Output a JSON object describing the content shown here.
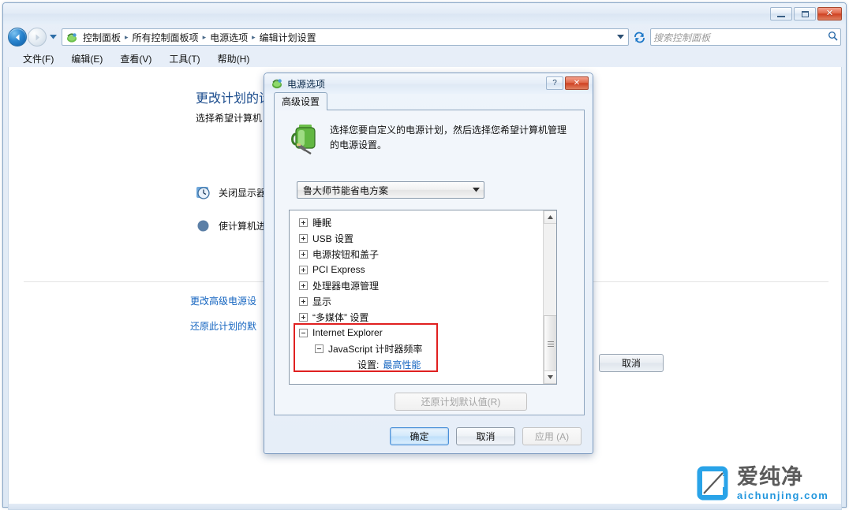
{
  "window": {
    "controls": {
      "minimize": "minimize-icon",
      "maximize": "maximize-icon",
      "close": "close-icon"
    }
  },
  "address_bar": {
    "back_label": "←",
    "forward_label": "→",
    "dropdown_label": "▼",
    "refresh_label": "↻",
    "breadcrumbs": [
      "控制面板",
      "所有控制面板项",
      "电源选项",
      "编辑计划设置"
    ],
    "separator": "▸"
  },
  "search": {
    "placeholder": "搜索控制面板",
    "icon_label": "⌕"
  },
  "menubar": {
    "items": [
      {
        "label": "文件(F)"
      },
      {
        "label": "编辑(E)"
      },
      {
        "label": "查看(V)"
      },
      {
        "label": "工具(T)"
      },
      {
        "label": "帮助(H)"
      }
    ]
  },
  "page": {
    "title": "更改计划的设",
    "subtitle": "选择希望计算机",
    "settings": [
      {
        "label": "关闭显示器",
        "icon": "clock-icon"
      },
      {
        "label": "使计算机进",
        "icon": "moon-icon"
      }
    ],
    "links": [
      {
        "label": "更改高级电源设"
      },
      {
        "label": "还原此计划的默"
      }
    ],
    "cancel_button": "取消"
  },
  "dialog": {
    "title": "电源选项",
    "help_label": "?",
    "close_label": "✕",
    "tab": "高级设置",
    "description": "选择您要自定义的电源计划，然后选择您希望计算机管理的电源设置。",
    "plan_combo": {
      "value": "鲁大师节能省电方案",
      "arrow": "▼"
    },
    "tree": [
      {
        "label": "睡眠",
        "expanded": false,
        "indent": 0
      },
      {
        "label": "USB 设置",
        "expanded": false,
        "indent": 0
      },
      {
        "label": "电源按钮和盖子",
        "expanded": false,
        "indent": 0
      },
      {
        "label": "PCI Express",
        "expanded": false,
        "indent": 0
      },
      {
        "label": "处理器电源管理",
        "expanded": false,
        "indent": 0
      },
      {
        "label": "显示",
        "expanded": false,
        "indent": 0
      },
      {
        "label": "“多媒体” 设置",
        "expanded": false,
        "indent": 0
      },
      {
        "label": "Internet Explorer",
        "expanded": true,
        "indent": 0
      },
      {
        "label": "JavaScript 计时器频率",
        "expanded": true,
        "indent": 1
      }
    ],
    "tree_leaf": {
      "label": "设置:",
      "value": "最高性能"
    },
    "highlight_color": "#e02020",
    "restore_button": "还原计划默认值(R)",
    "buttons": [
      {
        "label": "确定",
        "style": "default"
      },
      {
        "label": "取消",
        "style": "normal"
      },
      {
        "label": "应用 (A)",
        "style": "disabled"
      }
    ],
    "scrollbar": {
      "up": "▲",
      "down": "▼"
    }
  },
  "watermark": {
    "cn": "爱纯净",
    "en": "aichunjing.com",
    "accent": "#2196dd"
  }
}
